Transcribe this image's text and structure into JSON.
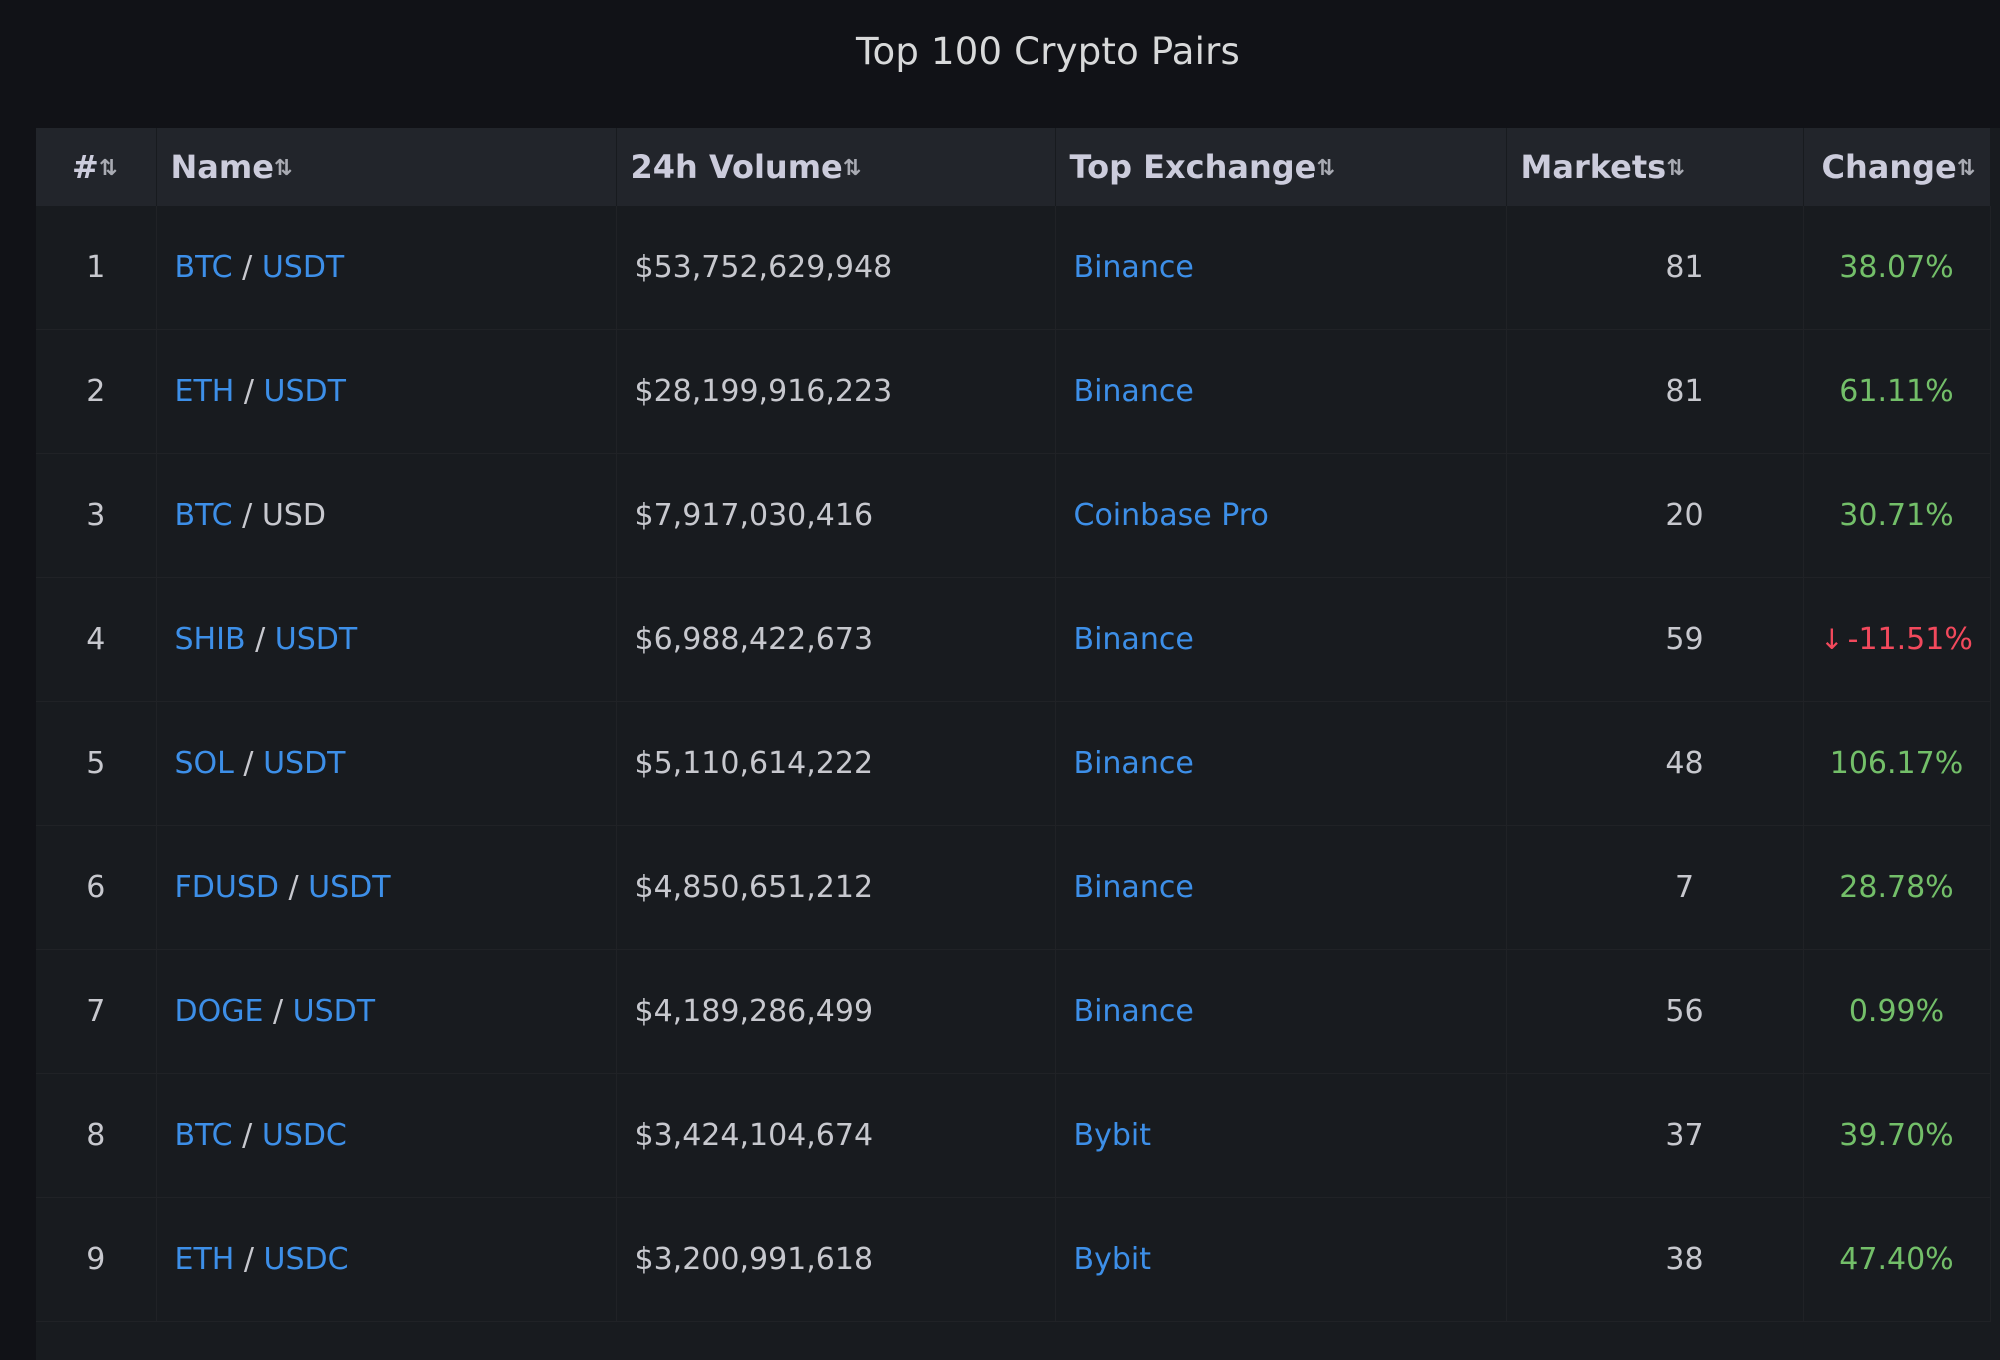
{
  "panel": {
    "title": "Top 100 Crypto Pairs"
  },
  "columns": [
    {
      "label": "#",
      "sort_icon": "sort-icon"
    },
    {
      "label": "Name",
      "sort_icon": "sort-icon"
    },
    {
      "label": "24h Volume",
      "sort_icon": "sort-icon"
    },
    {
      "label": "Top Exchange",
      "sort_icon": "sort-icon"
    },
    {
      "label": "Markets",
      "sort_icon": "sort-icon"
    },
    {
      "label": "Change",
      "sort_icon": "sort-icon"
    }
  ],
  "rows": [
    {
      "rank": "1",
      "base": "BTC",
      "sep": "/",
      "quote": "USDT",
      "quote_link": true,
      "volume": "$53,752,629,948",
      "exchange": "Binance",
      "markets": "81",
      "change": "38.07%",
      "negative": false
    },
    {
      "rank": "2",
      "base": "ETH",
      "sep": "/",
      "quote": "USDT",
      "quote_link": true,
      "volume": "$28,199,916,223",
      "exchange": "Binance",
      "markets": "81",
      "change": "61.11%",
      "negative": false
    },
    {
      "rank": "3",
      "base": "BTC",
      "sep": "/",
      "quote": "USD",
      "quote_link": false,
      "volume": "$7,917,030,416",
      "exchange": "Coinbase Pro",
      "markets": "20",
      "change": "30.71%",
      "negative": false
    },
    {
      "rank": "4",
      "base": "SHIB",
      "sep": "/",
      "quote": "USDT",
      "quote_link": true,
      "volume": "$6,988,422,673",
      "exchange": "Binance",
      "markets": "59",
      "change": "-11.51%",
      "negative": true
    },
    {
      "rank": "5",
      "base": "SOL",
      "sep": "/",
      "quote": "USDT",
      "quote_link": true,
      "volume": "$5,110,614,222",
      "exchange": "Binance",
      "markets": "48",
      "change": "106.17%",
      "negative": false
    },
    {
      "rank": "6",
      "base": "FDUSD",
      "sep": "/",
      "quote": "USDT",
      "quote_link": true,
      "volume": "$4,850,651,212",
      "exchange": "Binance",
      "markets": "7",
      "change": "28.78%",
      "negative": false
    },
    {
      "rank": "7",
      "base": "DOGE",
      "sep": "/",
      "quote": "USDT",
      "quote_link": true,
      "volume": "$4,189,286,499",
      "exchange": "Binance",
      "markets": "56",
      "change": "0.99%",
      "negative": false
    },
    {
      "rank": "8",
      "base": "BTC",
      "sep": "/",
      "quote": "USDC",
      "quote_link": true,
      "volume": "$3,424,104,674",
      "exchange": "Bybit",
      "markets": "37",
      "change": "39.70%",
      "negative": false
    },
    {
      "rank": "9",
      "base": "ETH",
      "sep": "/",
      "quote": "USDC",
      "quote_link": true,
      "volume": "$3,200,991,618",
      "exchange": "Bybit",
      "markets": "38",
      "change": "47.40%",
      "negative": false
    }
  ],
  "colors": {
    "link": "#3d8fe8",
    "positive": "#73bf69",
    "negative": "#f2495c",
    "panel_bg": "#181b1f",
    "header_bg": "#22252b"
  }
}
